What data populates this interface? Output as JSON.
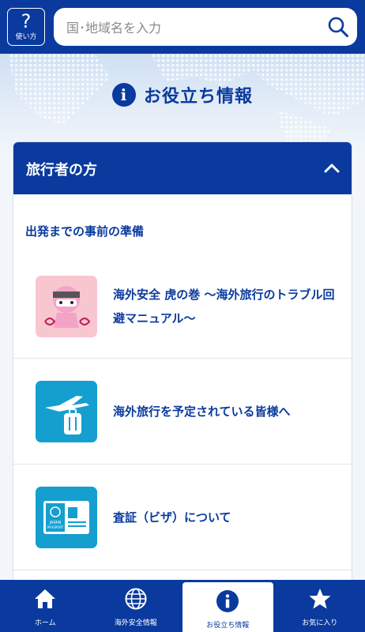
{
  "header": {
    "help_label": "使い方",
    "search_placeholder": "国･地域名を入力"
  },
  "hero": {
    "title": "お役立ち情報"
  },
  "card": {
    "title": "旅行者の方",
    "section_label": "出発までの事前の準備",
    "items": [
      {
        "label": "海外安全 虎の巻 〜海外旅行のトラブル回避マニュアル〜",
        "thumb_icon": "ninja-mascot-icon"
      },
      {
        "label": "海外旅行を予定されている皆様へ",
        "thumb_icon": "airplane-luggage-icon"
      },
      {
        "label": "査証（ビザ）について",
        "thumb_icon": "passport-icon"
      }
    ]
  },
  "passport_text": {
    "line1": "JAPAN",
    "line2": "PASSPORT"
  },
  "nav": {
    "items": [
      {
        "label": "ホーム",
        "icon": "home-icon"
      },
      {
        "label": "海外安全情報",
        "icon": "globe-icon"
      },
      {
        "label": "お役立ち情報",
        "icon": "info-icon"
      },
      {
        "label": "お気に入り",
        "icon": "star-icon"
      }
    ],
    "active_index": 2
  },
  "colors": {
    "brand": "#0a3a9e",
    "accent": "#149fcf",
    "pink": "#f8c6cf"
  }
}
